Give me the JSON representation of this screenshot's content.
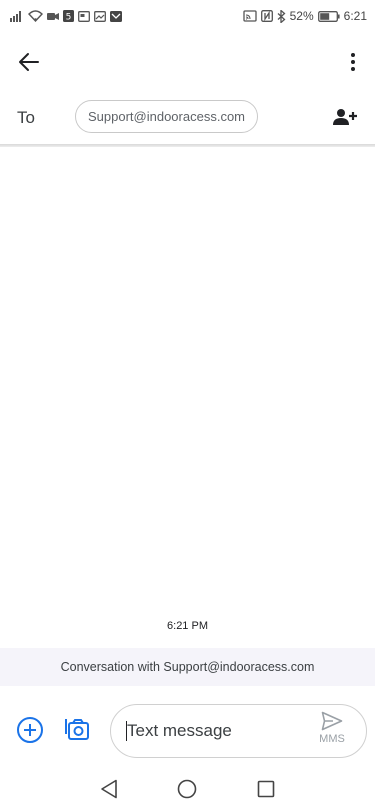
{
  "status_bar": {
    "battery_percent": "52%",
    "time": "6:21",
    "left_icons": [
      "signal-icon",
      "wifi-icon",
      "camera-icon",
      "app-notification-icon",
      "card-icon",
      "gallery-icon",
      "mail-icon"
    ],
    "right_icons": [
      "cast-icon",
      "nfc-icon",
      "bluetooth-icon",
      "battery-icon"
    ]
  },
  "app_bar": {
    "back_icon": "back-arrow-icon",
    "more_icon": "more-vert-icon"
  },
  "to_row": {
    "label": "To",
    "recipient": "Support@indooracess.com",
    "add_contact_icon": "add-person-icon"
  },
  "conversation": {
    "timestamp": "6:21 PM",
    "banner": "Conversation with Support@indooracess.com"
  },
  "compose": {
    "placeholder": "Text message",
    "value": "",
    "send_type": "MMS",
    "accent_color": "#1a73e8"
  },
  "nav_bar": {
    "icons": [
      "nav-back-icon",
      "nav-home-icon",
      "nav-recents-icon"
    ]
  }
}
